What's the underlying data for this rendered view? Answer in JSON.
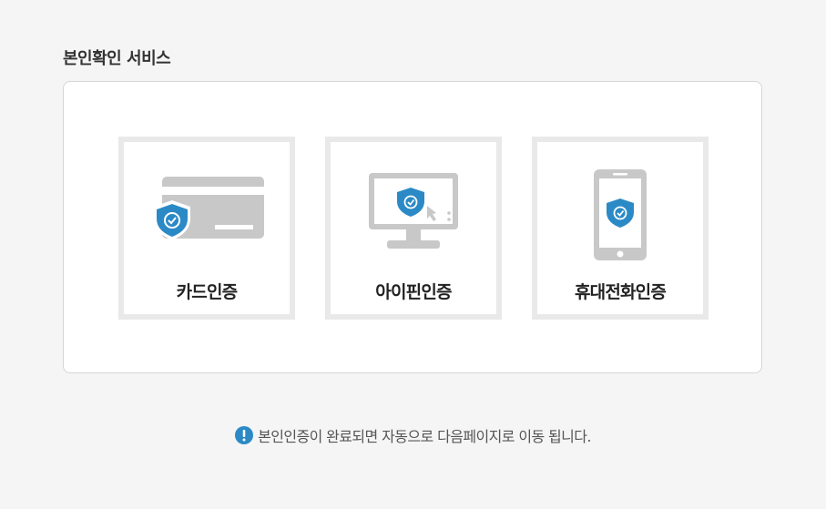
{
  "page": {
    "title": "본인확인 서비스",
    "notice": "본인인증이 완료되면 자동으로 다음페이지로 이동 됩니다."
  },
  "options": [
    {
      "label": "카드인증",
      "icon": "credit-card-shield-icon"
    },
    {
      "label": "아이핀인증",
      "icon": "monitor-shield-icon"
    },
    {
      "label": "휴대전화인증",
      "icon": "phone-shield-icon"
    }
  ],
  "colors": {
    "accent": "#2b8ac6",
    "icon_gray": "#c8c8c8",
    "card_border": "#e9e9e9",
    "background": "#f5f5f5"
  }
}
